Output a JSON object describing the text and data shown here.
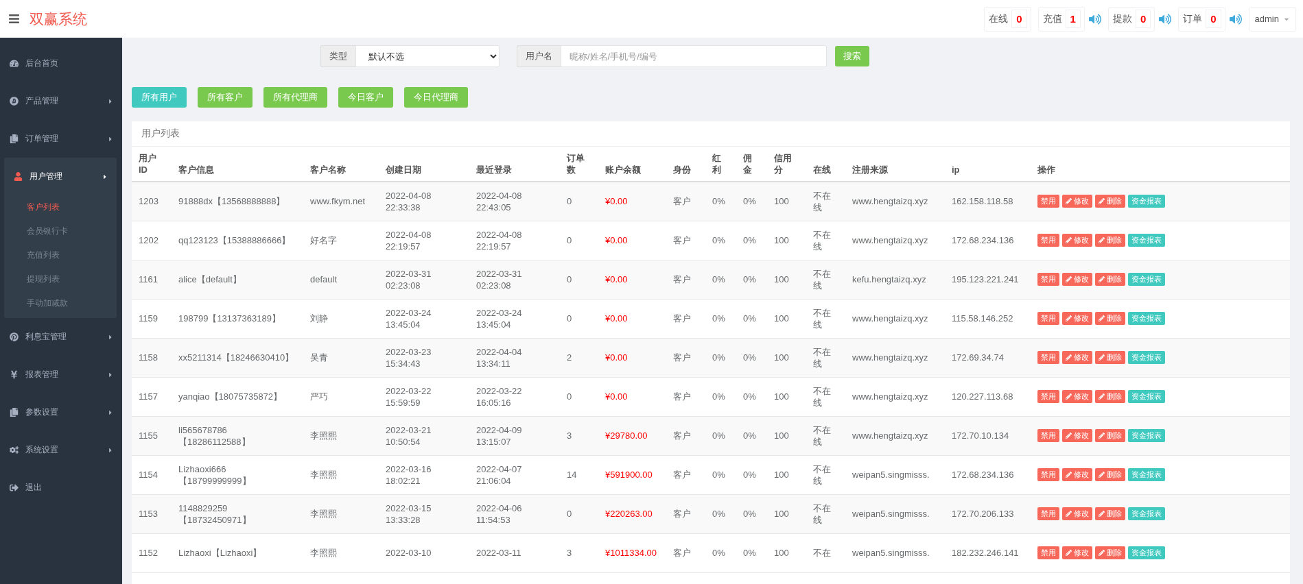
{
  "header": {
    "title": "双赢系统",
    "counters": [
      {
        "label": "在线",
        "value": "0",
        "alert": false
      },
      {
        "label": "充值",
        "value": "1",
        "alert": true
      },
      {
        "label": "提款",
        "value": "0",
        "alert": true
      },
      {
        "label": "订单",
        "value": "0",
        "alert": true
      }
    ],
    "user": "admin"
  },
  "sidebar": {
    "items": [
      {
        "label": "后台首页"
      },
      {
        "label": "产品管理",
        "expanded": false,
        "has_submenu": true
      },
      {
        "label": "订单管理",
        "expanded": false,
        "has_submenu": true
      },
      {
        "label": "用户管理",
        "expanded": true,
        "has_submenu": true,
        "children": [
          {
            "label": "客户列表",
            "selected": true
          },
          {
            "label": "会员银行卡",
            "selected": false
          },
          {
            "label": "充值列表",
            "selected": false
          },
          {
            "label": "提现列表",
            "selected": false
          },
          {
            "label": "手动加减款",
            "selected": false
          }
        ]
      },
      {
        "label": "利息宝管理",
        "expanded": false,
        "has_submenu": true
      },
      {
        "label": "报表管理",
        "expanded": false,
        "has_submenu": true
      },
      {
        "label": "参数设置",
        "expanded": false,
        "has_submenu": true
      },
      {
        "label": "系统设置",
        "expanded": false,
        "has_submenu": true
      },
      {
        "label": "退出"
      }
    ]
  },
  "filters": {
    "type_label": "类型",
    "type_value": "默认不选",
    "user_label": "用户名",
    "user_placeholder": "昵称/姓名/手机号/编号",
    "search_button": "搜索"
  },
  "quick_filters": [
    {
      "label": "所有用户",
      "selected": true
    },
    {
      "label": "所有客户",
      "selected": false
    },
    {
      "label": "所有代理商",
      "selected": false
    },
    {
      "label": "今日客户",
      "selected": false
    },
    {
      "label": "今日代理商",
      "selected": false
    }
  ],
  "table": {
    "title": "用户列表",
    "columns": [
      "用户ID",
      "客户信息",
      "客户名称",
      "创建日期",
      "最近登录",
      "订单数",
      "账户余额",
      "身份",
      "红利",
      "佣金",
      "信用分",
      "在线",
      "注册来源",
      "ip",
      "操作"
    ],
    "rows": [
      {
        "cells": [
          "1203",
          "91888dx【13568888888】",
          "www.fkym.net",
          "2022-04-08 22:33:38",
          "2022-04-08 22:43:05",
          "0",
          "¥0.00",
          "客户",
          "0%",
          "0%",
          "100",
          "不在线",
          "www.hengtaizq.xyz",
          "162.158.118.58"
        ],
        "actions": [
          {
            "label": "禁用",
            "kind": "danger"
          },
          {
            "label": "修改",
            "kind": "pencil"
          },
          {
            "label": "删除",
            "kind": "pencil"
          },
          {
            "label": "资金报表",
            "kind": "info"
          }
        ]
      },
      {
        "cells": [
          "1202",
          "qq123123【15388886666】",
          "好名字",
          "2022-04-08 22:19:57",
          "2022-04-08 22:19:57",
          "0",
          "¥0.00",
          "客户",
          "0%",
          "0%",
          "100",
          "不在线",
          "www.hengtaizq.xyz",
          "172.68.234.136"
        ],
        "actions": [
          {
            "label": "禁用",
            "kind": "danger"
          },
          {
            "label": "修改",
            "kind": "pencil"
          },
          {
            "label": "删除",
            "kind": "pencil"
          },
          {
            "label": "资金报表",
            "kind": "info"
          }
        ]
      },
      {
        "cells": [
          "1161",
          "alice【default】",
          "default",
          "2022-03-31 02:23:08",
          "2022-03-31 02:23:08",
          "0",
          "¥0.00",
          "客户",
          "0%",
          "0%",
          "100",
          "不在线",
          "kefu.hengtaizq.xyz",
          "195.123.221.241"
        ],
        "actions": [
          {
            "label": "禁用",
            "kind": "danger"
          },
          {
            "label": "修改",
            "kind": "pencil"
          },
          {
            "label": "删除",
            "kind": "pencil"
          },
          {
            "label": "资金报表",
            "kind": "info"
          }
        ]
      },
      {
        "cells": [
          "1159",
          "198799【13137363189】",
          "刘静",
          "2022-03-24 13:45:04",
          "2022-03-24 13:45:04",
          "0",
          "¥0.00",
          "客户",
          "0%",
          "0%",
          "100",
          "不在线",
          "www.hengtaizq.xyz",
          "115.58.146.252"
        ],
        "actions": [
          {
            "label": "禁用",
            "kind": "danger"
          },
          {
            "label": "修改",
            "kind": "pencil"
          },
          {
            "label": "删除",
            "kind": "pencil"
          },
          {
            "label": "资金报表",
            "kind": "info"
          }
        ]
      },
      {
        "cells": [
          "1158",
          "xx5211314【18246630410】",
          "吴青",
          "2022-03-23 15:34:43",
          "2022-04-04 13:34:11",
          "2",
          "¥0.00",
          "客户",
          "0%",
          "0%",
          "100",
          "不在线",
          "www.hengtaizq.xyz",
          "172.69.34.74"
        ],
        "actions": [
          {
            "label": "禁用",
            "kind": "danger"
          },
          {
            "label": "修改",
            "kind": "pencil"
          },
          {
            "label": "删除",
            "kind": "pencil"
          },
          {
            "label": "资金报表",
            "kind": "info"
          }
        ]
      },
      {
        "cells": [
          "1157",
          "yanqiao【18075735872】",
          "严巧",
          "2022-03-22 15:59:59",
          "2022-03-22 16:05:16",
          "0",
          "¥0.00",
          "客户",
          "0%",
          "0%",
          "100",
          "不在线",
          "www.hengtaizq.xyz",
          "120.227.113.68"
        ],
        "actions": [
          {
            "label": "禁用",
            "kind": "danger"
          },
          {
            "label": "修改",
            "kind": "pencil"
          },
          {
            "label": "删除",
            "kind": "pencil"
          },
          {
            "label": "资金报表",
            "kind": "info"
          }
        ]
      },
      {
        "cells": [
          "1155",
          "li565678786【18286112588】",
          "李照熙",
          "2022-03-21 10:50:54",
          "2022-04-09 13:15:07",
          "3",
          "¥29780.00",
          "客户",
          "0%",
          "0%",
          "100",
          "不在线",
          "www.hengtaizq.xyz",
          "172.70.10.134"
        ],
        "actions": [
          {
            "label": "禁用",
            "kind": "danger"
          },
          {
            "label": "修改",
            "kind": "pencil"
          },
          {
            "label": "删除",
            "kind": "pencil"
          },
          {
            "label": "资金报表",
            "kind": "info"
          }
        ]
      },
      {
        "cells": [
          "1154",
          "Lizhaoxi666【18799999999】",
          "李照熙",
          "2022-03-16 18:02:21",
          "2022-04-07 21:06:04",
          "14",
          "¥591900.00",
          "客户",
          "0%",
          "0%",
          "100",
          "不在线",
          "weipan5.singmisss.",
          "172.68.234.136"
        ],
        "actions": [
          {
            "label": "禁用",
            "kind": "danger"
          },
          {
            "label": "修改",
            "kind": "pencil"
          },
          {
            "label": "删除",
            "kind": "pencil"
          },
          {
            "label": "资金报表",
            "kind": "info"
          }
        ]
      },
      {
        "cells": [
          "1153",
          "1148829259【18732450971】",
          "李照熙",
          "2022-03-15 13:33:28",
          "2022-04-06 11:54:53",
          "0",
          "¥220263.00",
          "客户",
          "0%",
          "0%",
          "100",
          "不在线",
          "weipan5.singmisss.",
          "172.70.206.133"
        ],
        "actions": [
          {
            "label": "禁用",
            "kind": "danger"
          },
          {
            "label": "修改",
            "kind": "pencil"
          },
          {
            "label": "删除",
            "kind": "pencil"
          },
          {
            "label": "资金报表",
            "kind": "info"
          }
        ]
      },
      {
        "cells": [
          "1152",
          "Lizhaoxi【Lizhaoxi】",
          "李照熙",
          "2022-03-10",
          "2022-03-11",
          "3",
          "¥1011334.00",
          "客户",
          "0%",
          "0%",
          "100",
          "不在",
          "weipan5.singmisss.",
          "182.232.246.141"
        ],
        "actions": [
          {
            "label": "禁用",
            "kind": "danger"
          },
          {
            "label": "修改",
            "kind": "pencil"
          },
          {
            "label": "删除",
            "kind": "pencil"
          },
          {
            "label": "资金报表",
            "kind": "info"
          }
        ]
      }
    ]
  }
}
